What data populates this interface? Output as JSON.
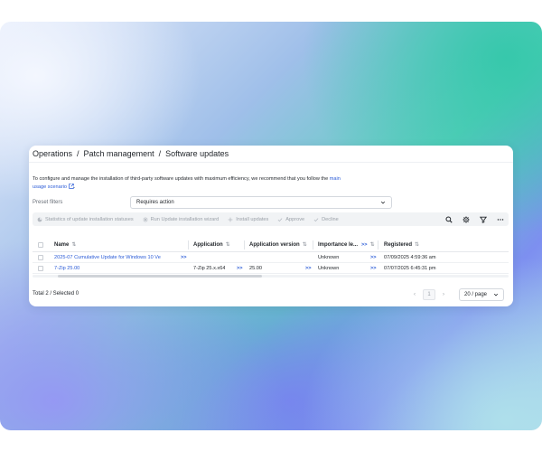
{
  "breadcrumb": [
    "Operations",
    "Patch management",
    "Software updates"
  ],
  "breadcrumb_separator": "/",
  "intro": {
    "text": "To configure and manage the installation of third-party software updates with maximum efficiency, we recommend that you follow the",
    "link_part1": "main",
    "link_part2": "usage scenario",
    "tail": "."
  },
  "preset": {
    "label": "Preset filters",
    "value": "Requires action"
  },
  "toolbar": {
    "stats": "Statistics of update installation statuses",
    "wizard": "Run Update installation wizard",
    "install": "Install updates",
    "approve": "Approve",
    "decline": "Decline"
  },
  "table": {
    "headers": {
      "name": "Name",
      "application": "Application",
      "app_version": "Application version",
      "importance": "Importance le...",
      "registered": "Registered"
    },
    "more_label": ">>",
    "rows": [
      {
        "name": "2025-07 Cumulative Update for Windows 10 Ve",
        "application": "",
        "app_version": "",
        "importance": "Unknown",
        "registered": "07/09/2025 4:59:36 am"
      },
      {
        "name": "7-Zip 25.00",
        "application": "7-Zip 25.x.x64",
        "app_version": "25.00",
        "importance": "Unknown",
        "registered": "07/07/2025 6:45:31 pm"
      }
    ]
  },
  "footer": {
    "total": "Total 2 / Selected 0",
    "prev": "‹",
    "page": "1",
    "next": "›",
    "page_size": "20 / page"
  },
  "colors": {
    "accent": "#2a5bd7",
    "toolbar_bg": "#f1f3f5"
  }
}
